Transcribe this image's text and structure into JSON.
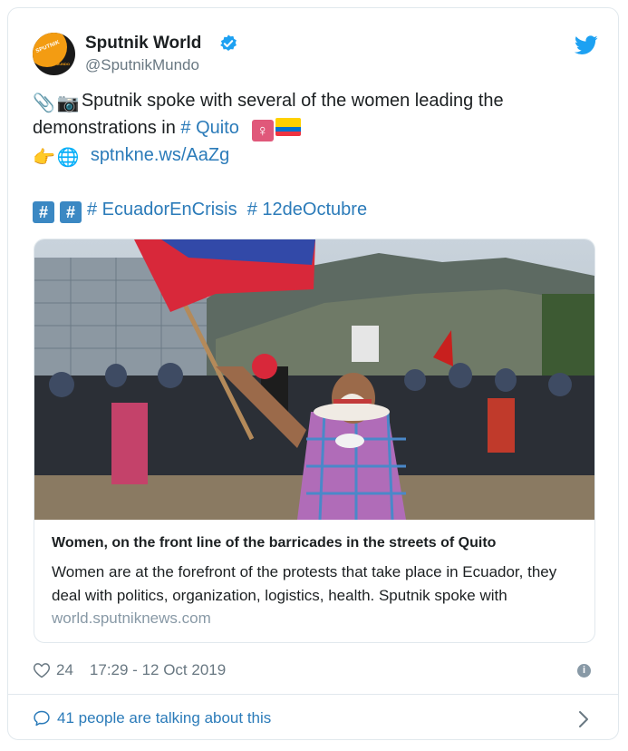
{
  "tweet": {
    "author_name": "Sputnik World",
    "author_handle": "@SputnikMundo",
    "avatar_text": "SPUTNIK",
    "avatar_sub": "MUNDO",
    "text_line1": "Sputnik spoke with several of the women leading the",
    "text_line2_prefix": "demonstrations in ",
    "quito_tag": "# Quito",
    "short_link": "sptnkne.ws/AaZg",
    "hashtag1": "# EcuadorEnCrisis",
    "hashtag2": "# 12deOctubre",
    "hash_symbol": "#",
    "venus_symbol": "♀",
    "emoji_pin": "📎",
    "emoji_camera": "📷",
    "emoji_point": "👉",
    "emoji_globe": "🌐"
  },
  "card": {
    "title": "Women, on the front line of the barricades in the streets of Quito",
    "description": "Women are at the forefront of the protests that take place in Ecuador, they deal with politics, organization, logistics, health. Sputnik spoke with",
    "domain": "world.sputniknews.com"
  },
  "footer": {
    "likes": "24",
    "timestamp": "17:29 - 12 Oct 2019",
    "info_symbol": "i",
    "talking": "41 people are talking about this"
  },
  "colors": {
    "link": "#2b7bb9",
    "secondary": "#697882",
    "border": "#e1e8ed",
    "twitter_blue": "#1da1f2"
  }
}
